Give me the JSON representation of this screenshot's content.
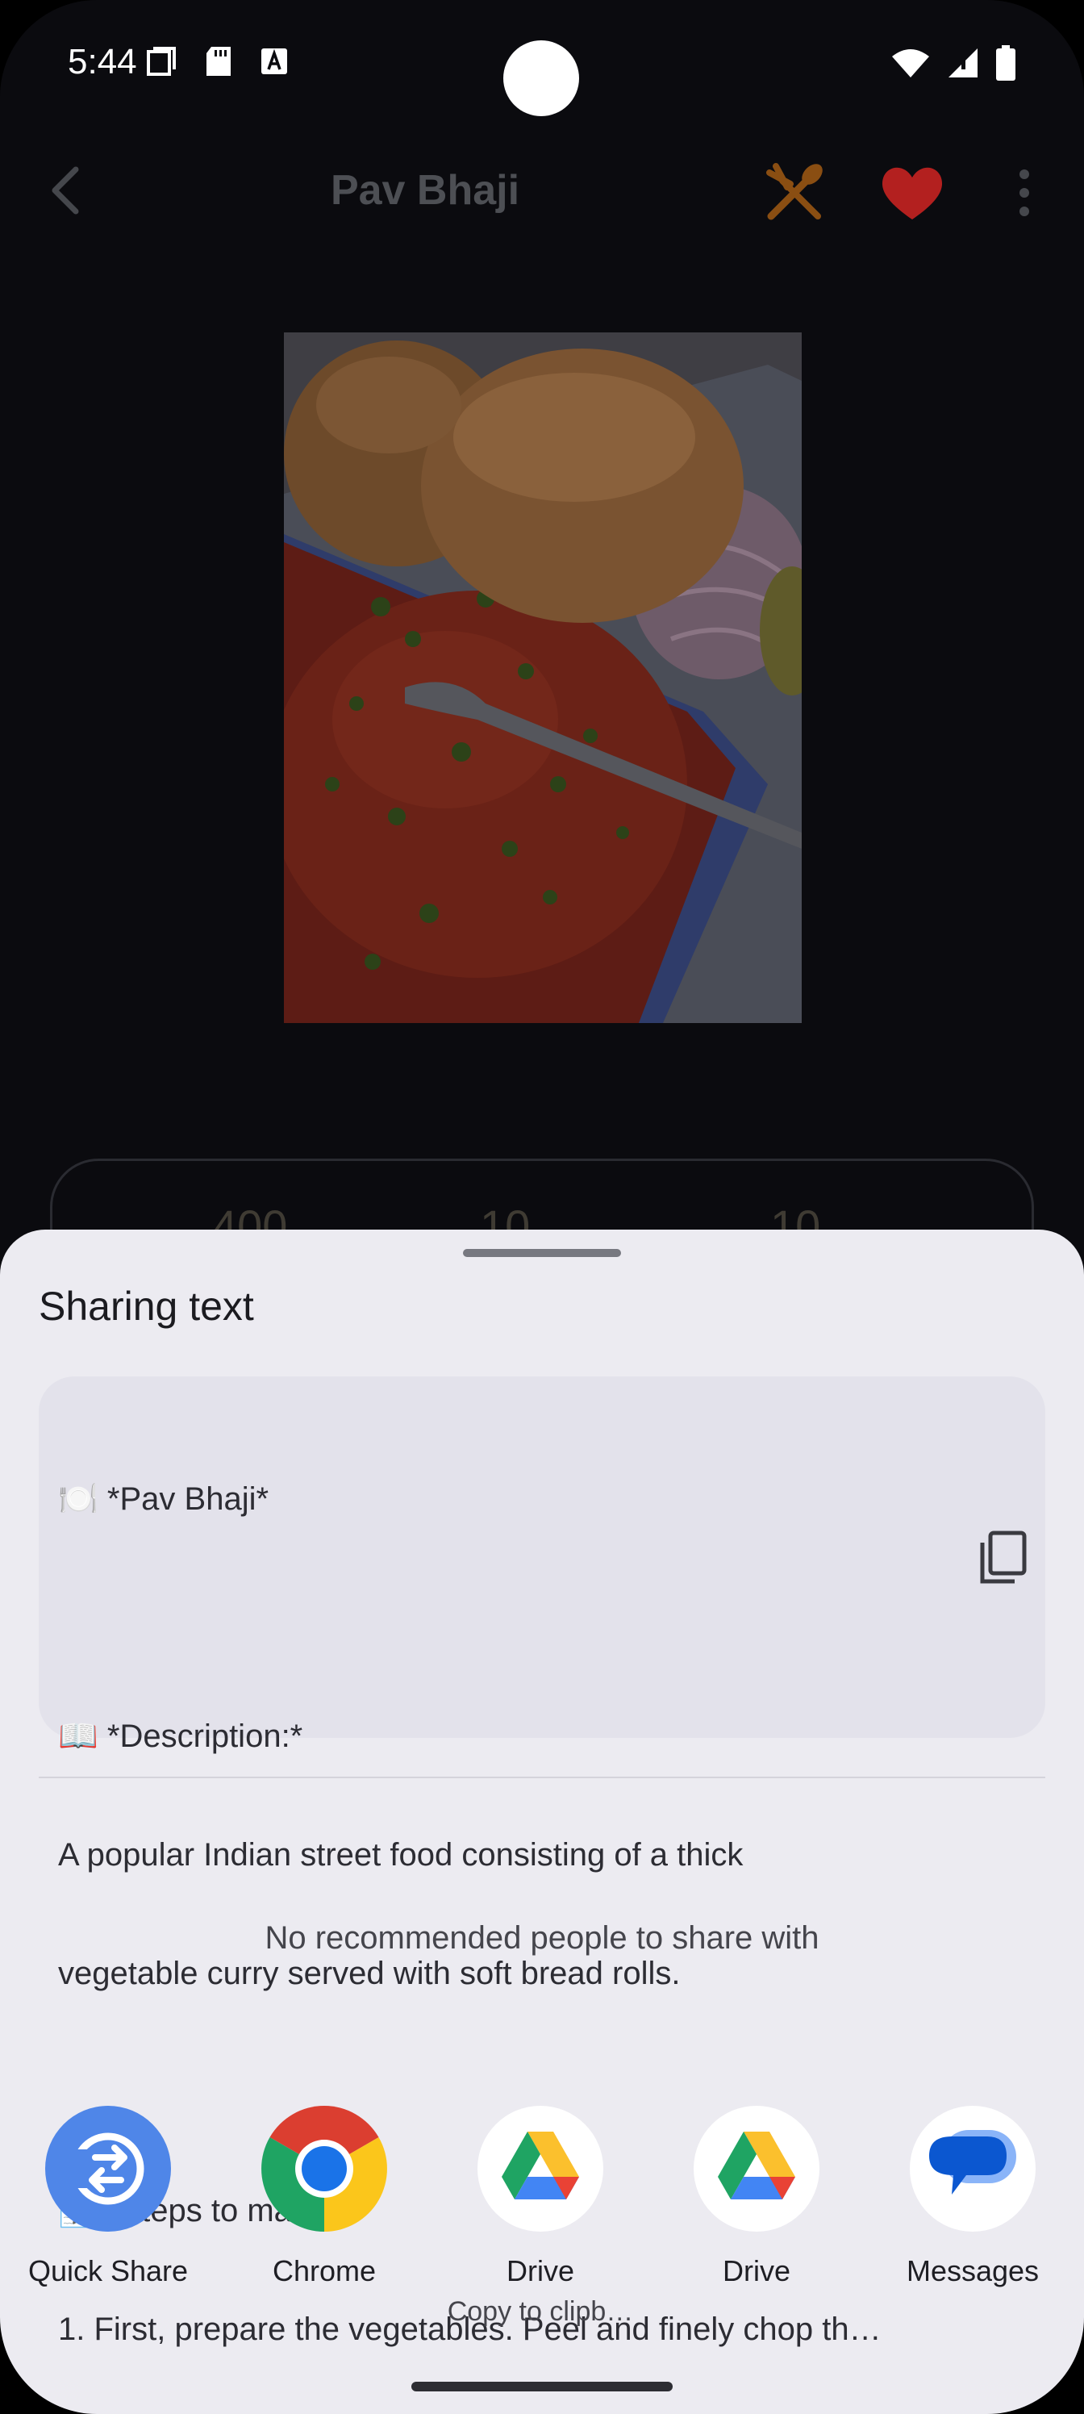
{
  "status_bar": {
    "time": "5:44",
    "left_icons": [
      "screen-icon",
      "sd-card-icon",
      "a-icon"
    ],
    "right_icons": [
      "wifi-icon",
      "signal-icon",
      "battery-icon"
    ]
  },
  "app_bar": {
    "title": "Pav Bhaji",
    "icons": [
      "back-arrow-icon",
      "utensils-icon",
      "heart-icon",
      "more-vert-icon"
    ]
  },
  "stats_card": {
    "values": [
      "400",
      "10",
      "10"
    ]
  },
  "share_sheet": {
    "title": "Sharing text",
    "preview_lines": [
      "🍽️ *Pav Bhaji*",
      "",
      "📖 *Description:*",
      "A popular Indian street food consisting of a thick",
      "vegetable curry served with soft bread rolls.",
      "",
      "📝 *Steps to make it:*",
      "1. First, prepare the vegetables. Peel and finely chop th…"
    ],
    "no_people_text": "No recommended people to share with",
    "targets": [
      {
        "label": "Quick Share",
        "sublabel": "",
        "icon": "quick-share-icon"
      },
      {
        "label": "Chrome",
        "sublabel": "",
        "icon": "chrome-icon"
      },
      {
        "label": "Drive",
        "sublabel": "Copy to clipb…",
        "icon": "drive-icon"
      },
      {
        "label": "Drive",
        "sublabel": "",
        "icon": "drive-icon"
      },
      {
        "label": "Messages",
        "sublabel": "",
        "icon": "messages-icon"
      }
    ]
  },
  "colors": {
    "sheet_background": "#ecebf1",
    "preview_background": "#e3e2eb",
    "heart": "#b3201f",
    "utensils": "#8a4e12",
    "quick_share": "#4f86e8"
  }
}
